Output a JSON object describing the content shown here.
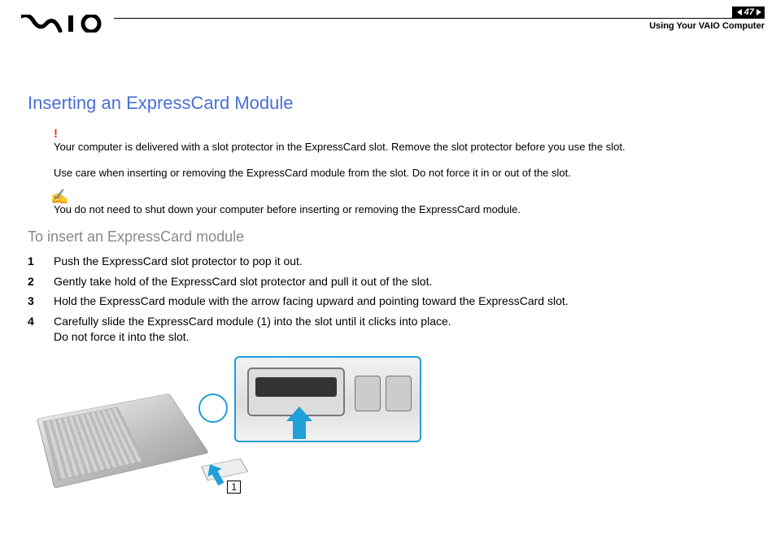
{
  "header": {
    "page_number": "47",
    "breadcrumb": "Using Your VAIO Computer"
  },
  "title": "Inserting an ExpressCard Module",
  "warning1": "Your computer is delivered with a slot protector in the ExpressCard slot. Remove the slot protector before you use the slot.",
  "warning2": "Use care when inserting or removing the ExpressCard module from the slot. Do not force it in or out of the slot.",
  "note": "You do not need to shut down your computer before inserting or removing the ExpressCard module.",
  "subtitle": "To insert an ExpressCard module",
  "steps": [
    "Push the ExpressCard slot protector to pop it out.",
    "Gently take hold of the ExpressCard slot protector and pull it out of the slot.",
    "Hold the ExpressCard module with the arrow facing upward and pointing toward the ExpressCard slot.",
    "Carefully slide the ExpressCard module (1) into the slot until it clicks into place.\nDo not force it into the slot."
  ],
  "figure": {
    "callout_1": "1"
  }
}
